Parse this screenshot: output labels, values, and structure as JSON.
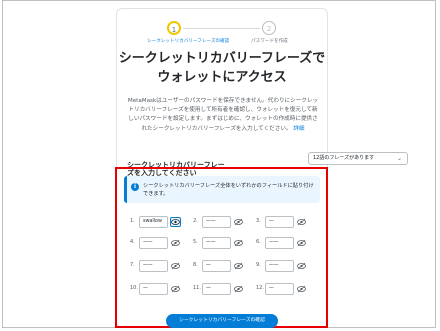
{
  "stepper": {
    "step1_number": "1",
    "step1_label": "シークレットリカバリーフレーズの確認",
    "step2_number": "2",
    "step2_label": "パスワードを作成"
  },
  "title_line1": "シークレットリカバリーフレーズで",
  "title_line2": "ウォレットにアクセス",
  "description": "MetaMaskはユーザーのパスワードを保存できません。代わりにシークレットリカバリーフレーズを使用して所有者を確認し、ウォレットを復元して新しいパスワードを設定します。まずはじめに、ウォレットの作成時に提供されたシークレットリカバリーフレーズを入力してください。",
  "details_link": "詳細",
  "dropdown": {
    "label": "シークレットリカバリーフレーズを入力してください",
    "value": "12語のフレーズがあります"
  },
  "info_banner": "シークレットリカバリーフレーズ全体をいずれかのフィールドに貼り付けできます。",
  "words": [
    {
      "num": "1.",
      "value": "swallow"
    },
    {
      "num": "2.",
      "value": "——"
    },
    {
      "num": "3.",
      "value": "—"
    },
    {
      "num": "4.",
      "value": "——"
    },
    {
      "num": "5.",
      "value": "——"
    },
    {
      "num": "6.",
      "value": "——"
    },
    {
      "num": "7.",
      "value": "——"
    },
    {
      "num": "8.",
      "value": "—"
    },
    {
      "num": "9.",
      "value": "——"
    },
    {
      "num": "10.",
      "value": "—"
    },
    {
      "num": "11.",
      "value": "—"
    },
    {
      "num": "12.",
      "value": "—"
    }
  ],
  "confirm_button": "シークレットリカバリーフレーズの確認",
  "colors": {
    "accent": "#037dd6",
    "highlight": "#e60000",
    "step_active": "#f3c600"
  },
  "icons": {
    "visible": "eye-icon",
    "hidden": "eye-slash-icon",
    "info": "info-icon",
    "dropdown": "chevron-down-icon"
  }
}
